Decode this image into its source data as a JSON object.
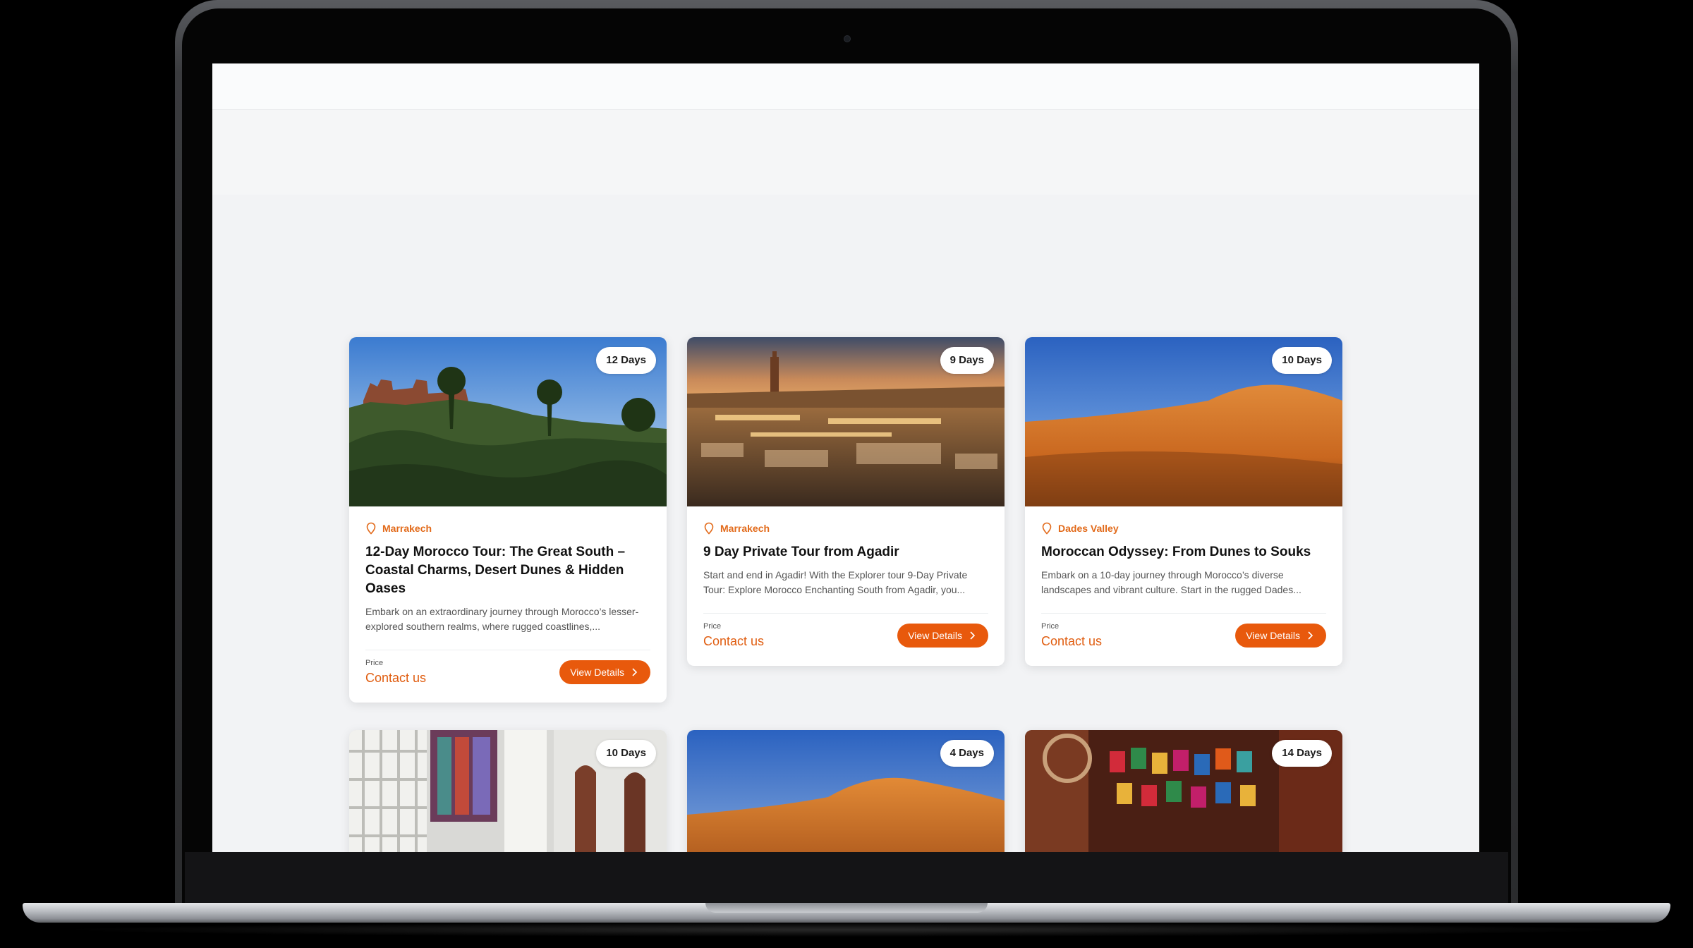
{
  "cards": [
    {
      "days": "12 Days",
      "location": "Marrakech",
      "title": "12-Day Morocco Tour: The Great South – Coastal Charms, Desert Dunes & Hidden Oases",
      "description": "Embark on an extraordinary journey through Morocco’s lesser-explored southern realms, where rugged coastlines,...",
      "price_label": "Price",
      "price_value": "Contact us",
      "button_label": "View Details"
    },
    {
      "days": "9 Days",
      "location": "Marrakech",
      "title": "9 Day Private Tour from Agadir",
      "description": "Start and end in Agadir! With the Explorer tour 9-Day Private Tour: Explore Morocco Enchanting South from Agadir, you...",
      "price_label": "Price",
      "price_value": "Contact us",
      "button_label": "View Details"
    },
    {
      "days": "10 Days",
      "location": "Dades Valley",
      "title": "Moroccan Odyssey: From Dunes to Souks",
      "description": "Embark on a 10-day journey through Morocco’s diverse landscapes and vibrant culture. Start in the rugged Dades...",
      "price_label": "Price",
      "price_value": "Contact us",
      "button_label": "View Details"
    },
    {
      "days": "10 Days"
    },
    {
      "days": "4 Days"
    },
    {
      "days": "14 Days"
    }
  ],
  "colors": {
    "accent": "#e8590c",
    "location_text": "#e26a1a"
  }
}
